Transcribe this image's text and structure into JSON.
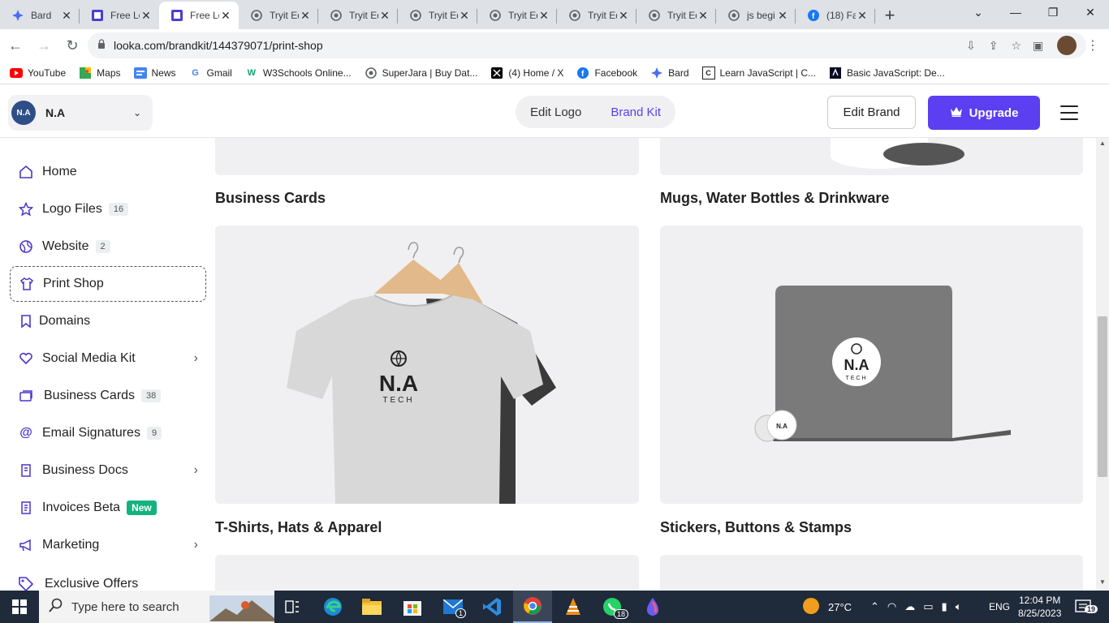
{
  "browser": {
    "tabs": [
      {
        "title": "Bard",
        "icon": "bard-icon",
        "active": false
      },
      {
        "title": "Free Lo",
        "icon": "looka-icon",
        "active": false
      },
      {
        "title": "Free Lo",
        "icon": "looka-icon",
        "active": true
      },
      {
        "title": "Tryit Ed",
        "icon": "globe-icon",
        "active": false
      },
      {
        "title": "Tryit Ed",
        "icon": "globe-icon",
        "active": false
      },
      {
        "title": "Tryit Ed",
        "icon": "globe-icon",
        "active": false
      },
      {
        "title": "Tryit Ed",
        "icon": "globe-icon",
        "active": false
      },
      {
        "title": "Tryit Ed",
        "icon": "globe-icon",
        "active": false
      },
      {
        "title": "Tryit Ed",
        "icon": "globe-icon",
        "active": false
      },
      {
        "title": "js begi",
        "icon": "globe-icon",
        "active": false
      },
      {
        "title": "(18) Fa",
        "icon": "facebook-icon",
        "active": false
      }
    ],
    "url": "looka.com/brandkit/144379071/print-shop",
    "bookmarks": [
      {
        "label": "YouTube",
        "icon": "youtube-icon",
        "color": "#ff0000"
      },
      {
        "label": "Maps",
        "icon": "maps-icon",
        "color": "#34a853"
      },
      {
        "label": "News",
        "icon": "news-icon",
        "color": "#4285f4"
      },
      {
        "label": "Gmail",
        "icon": "google-icon",
        "color": "#4285f4"
      },
      {
        "label": "W3Schools Online...",
        "icon": "w3schools-icon",
        "color": "#04aa6d"
      },
      {
        "label": "SuperJara | Buy Dat...",
        "icon": "globe-icon",
        "color": "#555555"
      },
      {
        "label": "(4) Home / X",
        "icon": "x-icon",
        "color": "#000000"
      },
      {
        "label": "Facebook",
        "icon": "facebook-icon",
        "color": "#1877f2"
      },
      {
        "label": "Bard",
        "icon": "bard-icon",
        "color": "#4a6cf7"
      },
      {
        "label": "Learn JavaScript | C...",
        "icon": "codecademy-icon",
        "color": "#1f1f1f"
      },
      {
        "label": "Basic JavaScript: De...",
        "icon": "freecodecamp-icon",
        "color": "#0a0a23"
      }
    ]
  },
  "header": {
    "brand_avatar": "N.A",
    "brand_name": "N.A",
    "edit_logo": "Edit Logo",
    "brand_kit": "Brand Kit",
    "edit_brand": "Edit Brand",
    "upgrade": "Upgrade"
  },
  "sidebar": {
    "items": [
      {
        "label": "Home",
        "icon": "home-icon"
      },
      {
        "label": "Logo Files",
        "icon": "star-icon",
        "count": "16"
      },
      {
        "label": "Website",
        "icon": "website-icon",
        "count": "2"
      },
      {
        "label": "Print Shop",
        "icon": "shirt-icon",
        "active": true
      },
      {
        "label": "Domains",
        "icon": "bookmark-icon"
      },
      {
        "label": "Social Media Kit",
        "icon": "heart-icon",
        "expandable": true
      },
      {
        "label": "Business Cards",
        "icon": "cards-icon",
        "count": "38"
      },
      {
        "label": "Email Signatures",
        "icon": "at-icon",
        "count": "9"
      },
      {
        "label": "Business Docs",
        "icon": "document-icon",
        "expandable": true
      },
      {
        "label": "Invoices Beta",
        "icon": "invoice-icon",
        "badge": "New"
      },
      {
        "label": "Marketing",
        "icon": "megaphone-icon",
        "expandable": true
      },
      {
        "label": "Exclusive Offers",
        "icon": "tag-icon"
      }
    ]
  },
  "main": {
    "products": [
      {
        "title": "Business Cards"
      },
      {
        "title": "Mugs, Water Bottles & Drinkware"
      },
      {
        "title": "T-Shirts, Hats & Apparel"
      },
      {
        "title": "Stickers, Buttons & Stamps"
      }
    ],
    "logo_text": "N.A",
    "logo_sub": "TECH"
  },
  "taskbar": {
    "search_placeholder": "Type here to search",
    "weather": "27°C",
    "lang": "ENG",
    "time": "12:04 PM",
    "date": "8/25/2023",
    "notifications": "19",
    "mail_badge": "1",
    "whatsapp_badge": "18"
  },
  "colors": {
    "accent": "#5b3ff0",
    "new_badge": "#14b37d"
  }
}
